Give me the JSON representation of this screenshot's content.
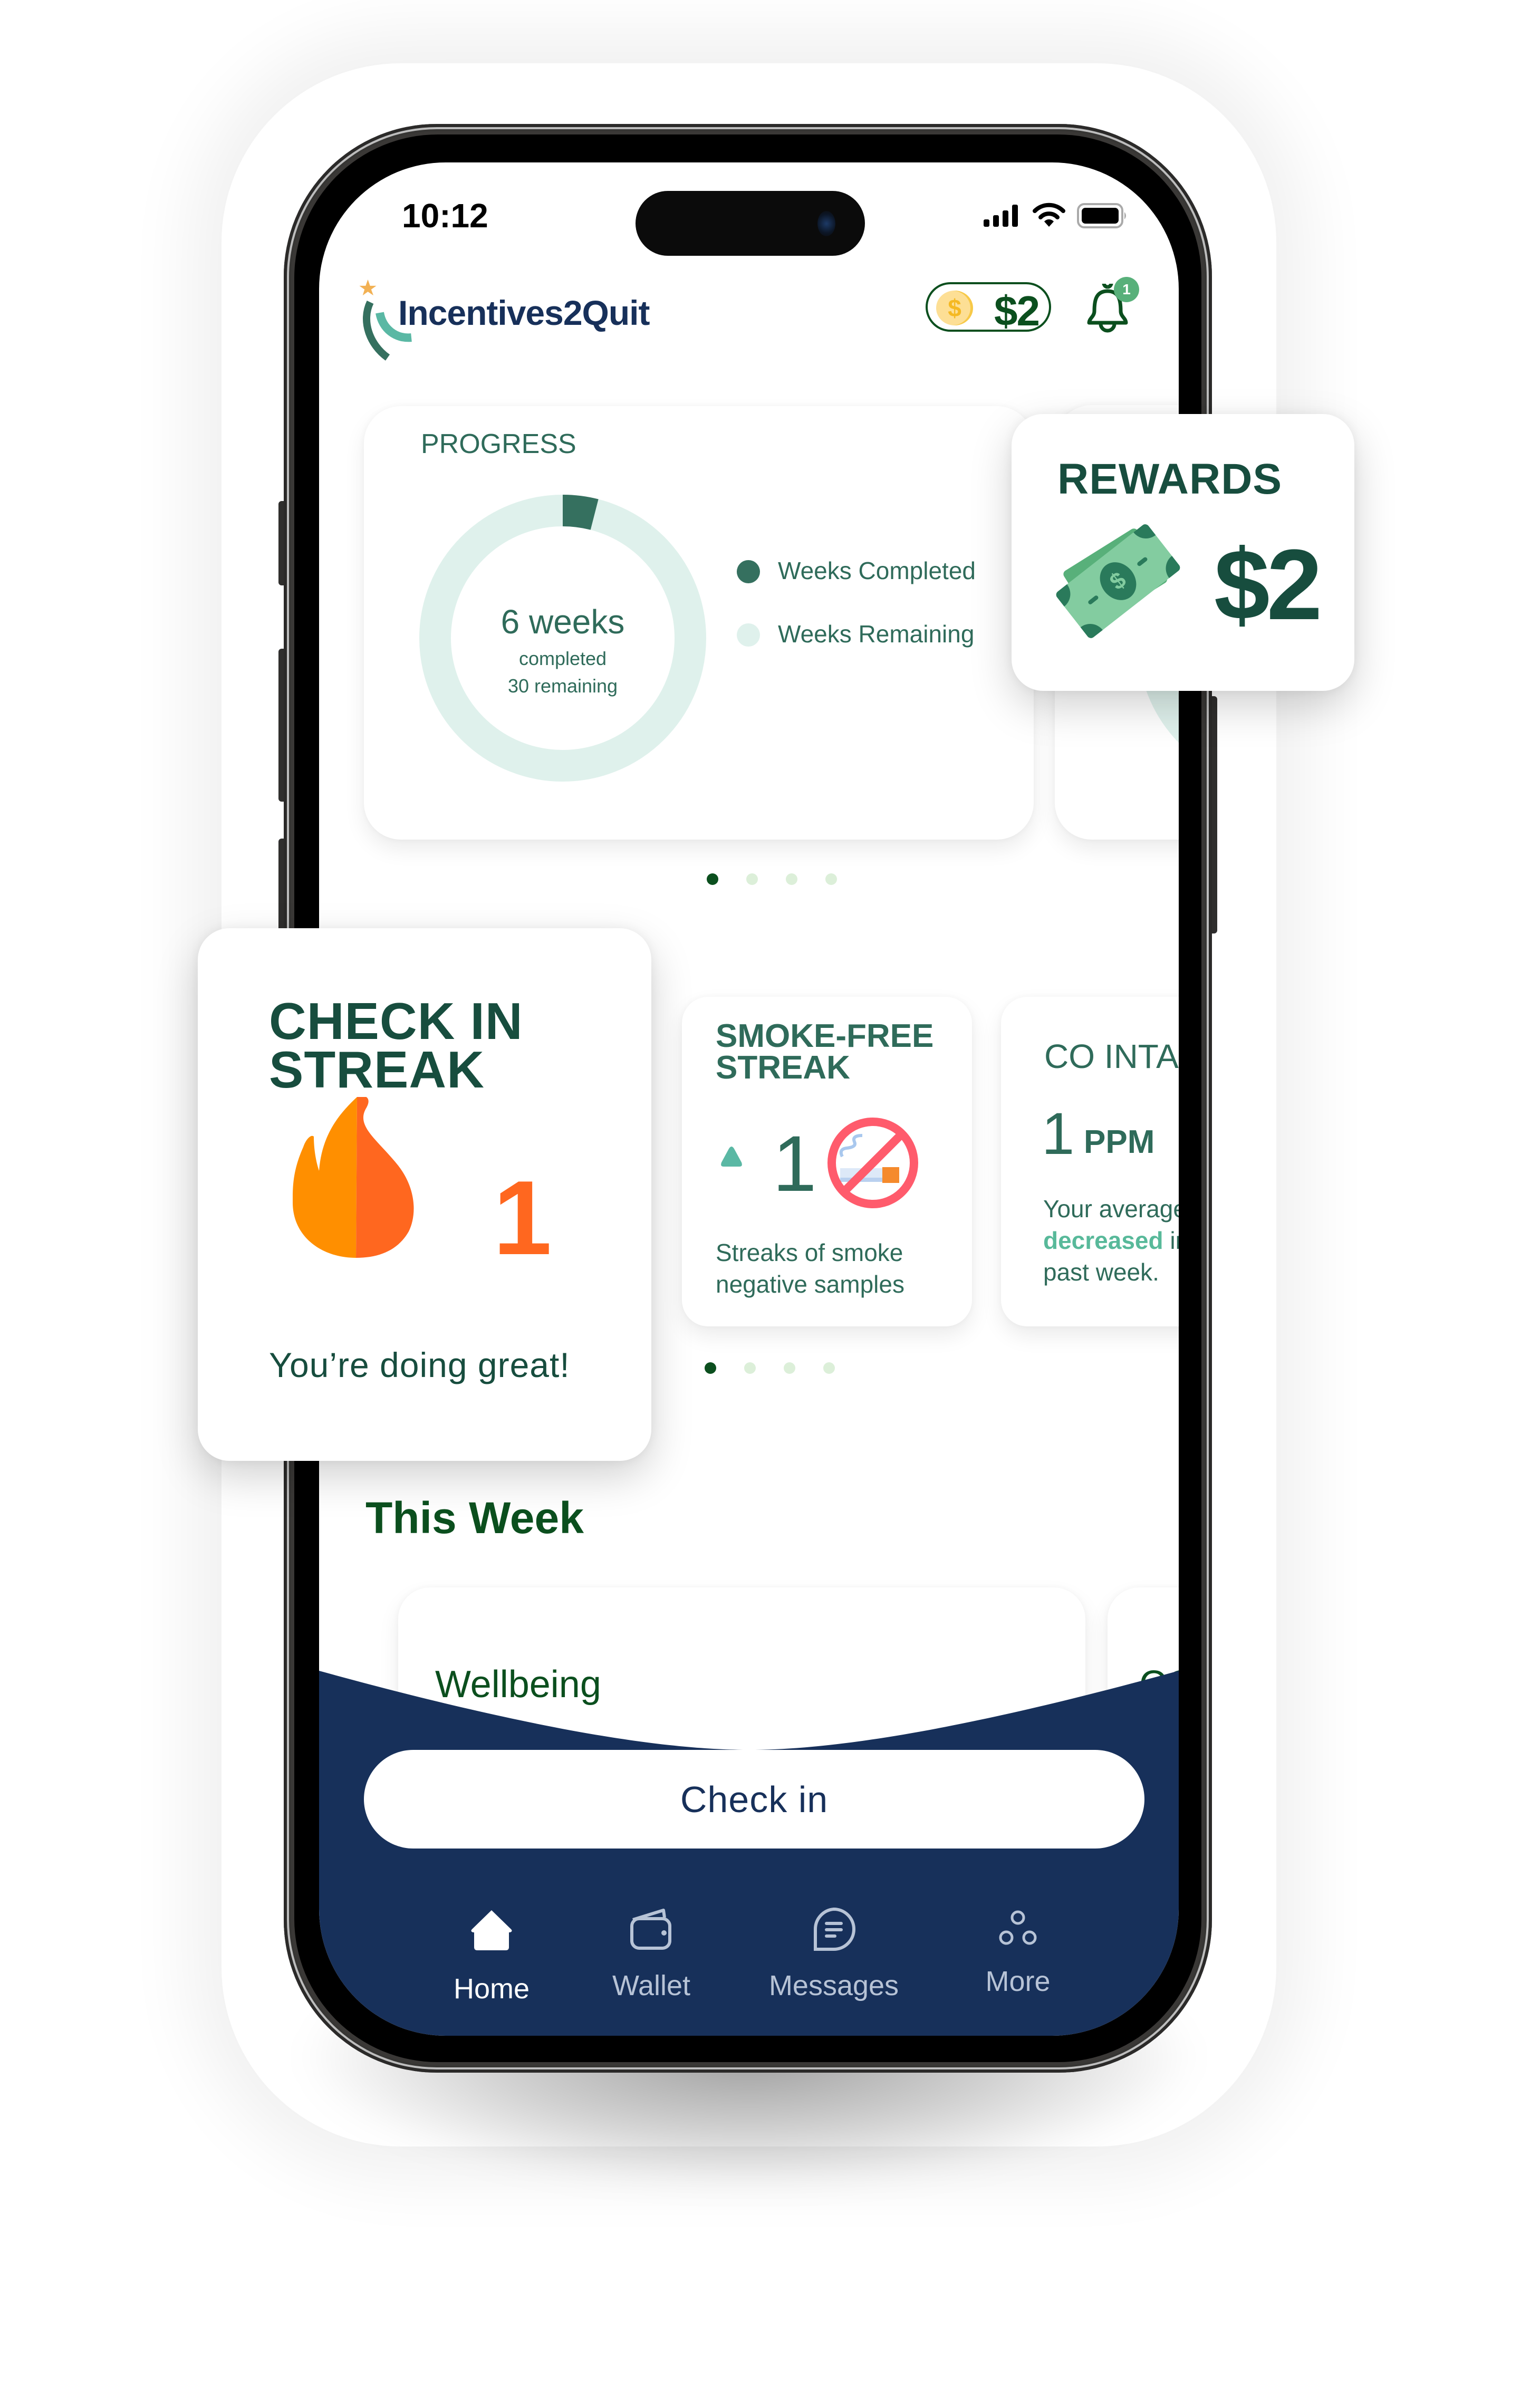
{
  "status_bar": {
    "time": "10:12",
    "icons": [
      "signal-icon",
      "wifi-icon",
      "battery-icon"
    ]
  },
  "header": {
    "app_name": "Incentives2Quit",
    "balance": "$2",
    "coin_symbol": "$",
    "notification_count": "1",
    "icons": [
      "logo-icon",
      "coin-icon",
      "bell-icon"
    ]
  },
  "progress_card": {
    "title": "PROGRESS",
    "center_value": "6 weeks",
    "center_line1": "completed",
    "center_line2": "30 remaining",
    "weeks_completed": 6,
    "weeks_remaining": 30,
    "legend": [
      {
        "label": "Weeks Completed",
        "color": "#35705f"
      },
      {
        "label": "Weeks Remaining",
        "color": "#dff1ec"
      }
    ]
  },
  "rewards_card": {
    "title": "REWARDS",
    "amount": "$2",
    "icon": "money-bill-icon"
  },
  "carousel_top": {
    "dots": 4,
    "active": 0
  },
  "checkin_streak": {
    "title_line1": "CHECK IN",
    "title_line2": "STREAK",
    "count": "1",
    "message": "You’re doing great!",
    "icon": "flame-icon"
  },
  "smoke_free_card": {
    "title_line1": "SMOKE-FREE",
    "title_line2": "STREAK",
    "count": "1",
    "description_line1": "Streaks of smoke",
    "description_line2": "negative samples",
    "icons": [
      "trend-up-icon",
      "no-smoking-icon"
    ]
  },
  "co_intake_card": {
    "title": "CO INTAK",
    "value": "1",
    "unit": "PPM",
    "desc_line1": "Your average",
    "desc_highlight": "decreased",
    "desc_after": " in",
    "desc_line3": "past week."
  },
  "carousel_middle": {
    "dots": 4,
    "active": 0
  },
  "this_week": {
    "title": "This Week",
    "cards": [
      {
        "title": "Wellbeing"
      },
      {
        "title": "CO"
      }
    ]
  },
  "checkin_button": {
    "label": "Check in"
  },
  "bottom_nav": {
    "items": [
      {
        "label": "Home",
        "icon": "home-icon",
        "active": true
      },
      {
        "label": "Wallet",
        "icon": "wallet-icon",
        "active": false
      },
      {
        "label": "Messages",
        "icon": "messages-icon",
        "active": false
      },
      {
        "label": "More",
        "icon": "more-icon",
        "active": false
      }
    ]
  },
  "colors": {
    "navy": "#17305a",
    "dark_green": "#174d3e",
    "green_text": "#2f6b5a",
    "accent_green": "#58b07a",
    "orange": "#ff671f",
    "dot_active": "#0b4f1e",
    "dot_inactive": "#dcefd9"
  }
}
